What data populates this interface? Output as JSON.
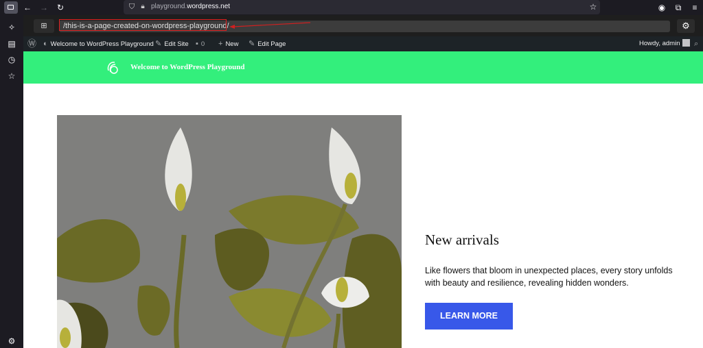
{
  "browser": {
    "url_domain": "playground.",
    "url_host": "wordpress.net",
    "url_suffix": ""
  },
  "playground": {
    "path": "/this-is-a-page-created-on-wordpress-playground/"
  },
  "adminbar": {
    "site_name": "Welcome to WordPress Playground",
    "edit_site": "Edit Site",
    "comments_count": "0",
    "new": "New",
    "edit_page": "Edit Page",
    "howdy": "Howdy, admin"
  },
  "site": {
    "title": "Welcome to WordPress Playground",
    "header_color": "#33ef7c"
  },
  "content": {
    "heading": "New arrivals",
    "text": "Like flowers that bloom in unexpected places, every story unfolds with beauty and resilience, revealing hidden wonders.",
    "button": "LEARN MORE",
    "button_color": "#3858e9"
  }
}
